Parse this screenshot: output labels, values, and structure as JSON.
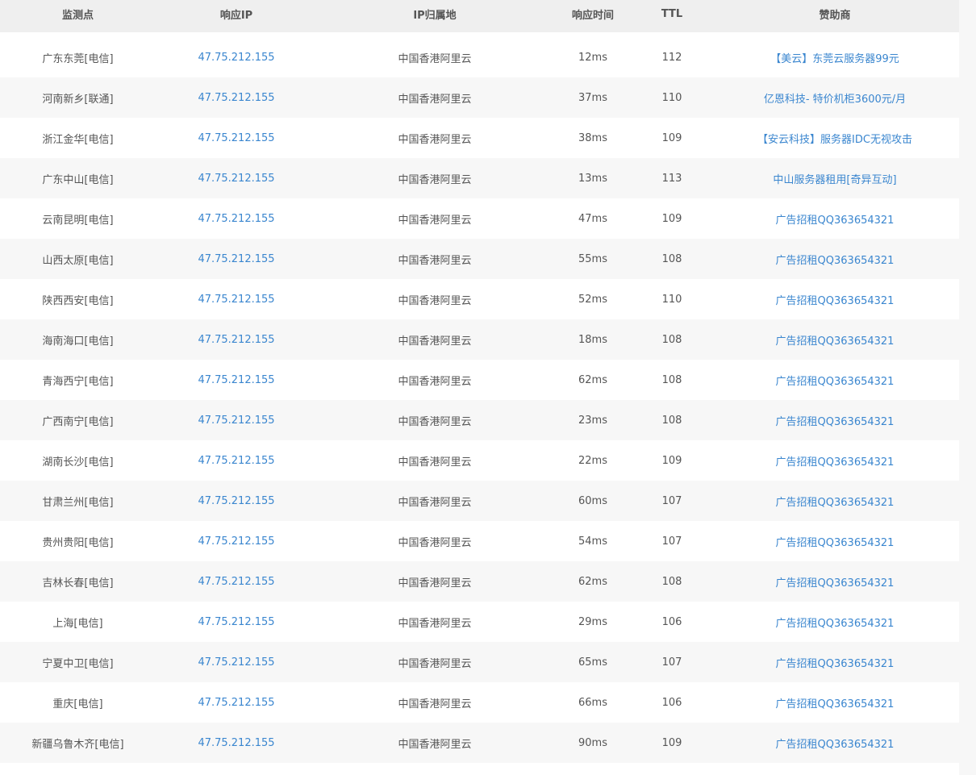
{
  "table": {
    "headers": {
      "node": "监测点",
      "ip": "响应IP",
      "location": "IP归属地",
      "time": "响应时间",
      "ttl": "TTL",
      "sponsor": "赞助商"
    },
    "rows": [
      {
        "node": "广东东莞[电信]",
        "ip": "47.75.212.155",
        "location": "中国香港阿里云",
        "time": "12ms",
        "ttl": "112",
        "sponsor": "【美云】东莞云服务器99元"
      },
      {
        "node": "河南新乡[联通]",
        "ip": "47.75.212.155",
        "location": "中国香港阿里云",
        "time": "37ms",
        "ttl": "110",
        "sponsor": "亿恩科技- 特价机柜3600元/月"
      },
      {
        "node": "浙江金华[电信]",
        "ip": "47.75.212.155",
        "location": "中国香港阿里云",
        "time": "38ms",
        "ttl": "109",
        "sponsor": "【安云科技】服务器IDC无视攻击"
      },
      {
        "node": "广东中山[电信]",
        "ip": "47.75.212.155",
        "location": "中国香港阿里云",
        "time": "13ms",
        "ttl": "113",
        "sponsor": "中山服务器租用[奇异互动]"
      },
      {
        "node": "云南昆明[电信]",
        "ip": "47.75.212.155",
        "location": "中国香港阿里云",
        "time": "47ms",
        "ttl": "109",
        "sponsor": "广告招租QQ363654321"
      },
      {
        "node": "山西太原[电信]",
        "ip": "47.75.212.155",
        "location": "中国香港阿里云",
        "time": "55ms",
        "ttl": "108",
        "sponsor": "广告招租QQ363654321"
      },
      {
        "node": "陕西西安[电信]",
        "ip": "47.75.212.155",
        "location": "中国香港阿里云",
        "time": "52ms",
        "ttl": "110",
        "sponsor": "广告招租QQ363654321"
      },
      {
        "node": "海南海口[电信]",
        "ip": "47.75.212.155",
        "location": "中国香港阿里云",
        "time": "18ms",
        "ttl": "108",
        "sponsor": "广告招租QQ363654321"
      },
      {
        "node": "青海西宁[电信]",
        "ip": "47.75.212.155",
        "location": "中国香港阿里云",
        "time": "62ms",
        "ttl": "108",
        "sponsor": "广告招租QQ363654321"
      },
      {
        "node": "广西南宁[电信]",
        "ip": "47.75.212.155",
        "location": "中国香港阿里云",
        "time": "23ms",
        "ttl": "108",
        "sponsor": "广告招租QQ363654321"
      },
      {
        "node": "湖南长沙[电信]",
        "ip": "47.75.212.155",
        "location": "中国香港阿里云",
        "time": "22ms",
        "ttl": "109",
        "sponsor": "广告招租QQ363654321"
      },
      {
        "node": "甘肃兰州[电信]",
        "ip": "47.75.212.155",
        "location": "中国香港阿里云",
        "time": "60ms",
        "ttl": "107",
        "sponsor": "广告招租QQ363654321"
      },
      {
        "node": "贵州贵阳[电信]",
        "ip": "47.75.212.155",
        "location": "中国香港阿里云",
        "time": "54ms",
        "ttl": "107",
        "sponsor": "广告招租QQ363654321"
      },
      {
        "node": "吉林长春[电信]",
        "ip": "47.75.212.155",
        "location": "中国香港阿里云",
        "time": "62ms",
        "ttl": "108",
        "sponsor": "广告招租QQ363654321"
      },
      {
        "node": "上海[电信]",
        "ip": "47.75.212.155",
        "location": "中国香港阿里云",
        "time": "29ms",
        "ttl": "106",
        "sponsor": "广告招租QQ363654321"
      },
      {
        "node": "宁夏中卫[电信]",
        "ip": "47.75.212.155",
        "location": "中国香港阿里云",
        "time": "65ms",
        "ttl": "107",
        "sponsor": "广告招租QQ363654321"
      },
      {
        "node": "重庆[电信]",
        "ip": "47.75.212.155",
        "location": "中国香港阿里云",
        "time": "66ms",
        "ttl": "106",
        "sponsor": "广告招租QQ363654321"
      },
      {
        "node": "新疆乌鲁木齐[电信]",
        "ip": "47.75.212.155",
        "location": "中国香港阿里云",
        "time": "90ms",
        "ttl": "109",
        "sponsor": "广告招租QQ363654321"
      }
    ]
  },
  "colors": {
    "link": "#3a86cf",
    "text": "#555555",
    "header_bg": "#efefef",
    "stripe_bg": "#f7f7f7"
  }
}
